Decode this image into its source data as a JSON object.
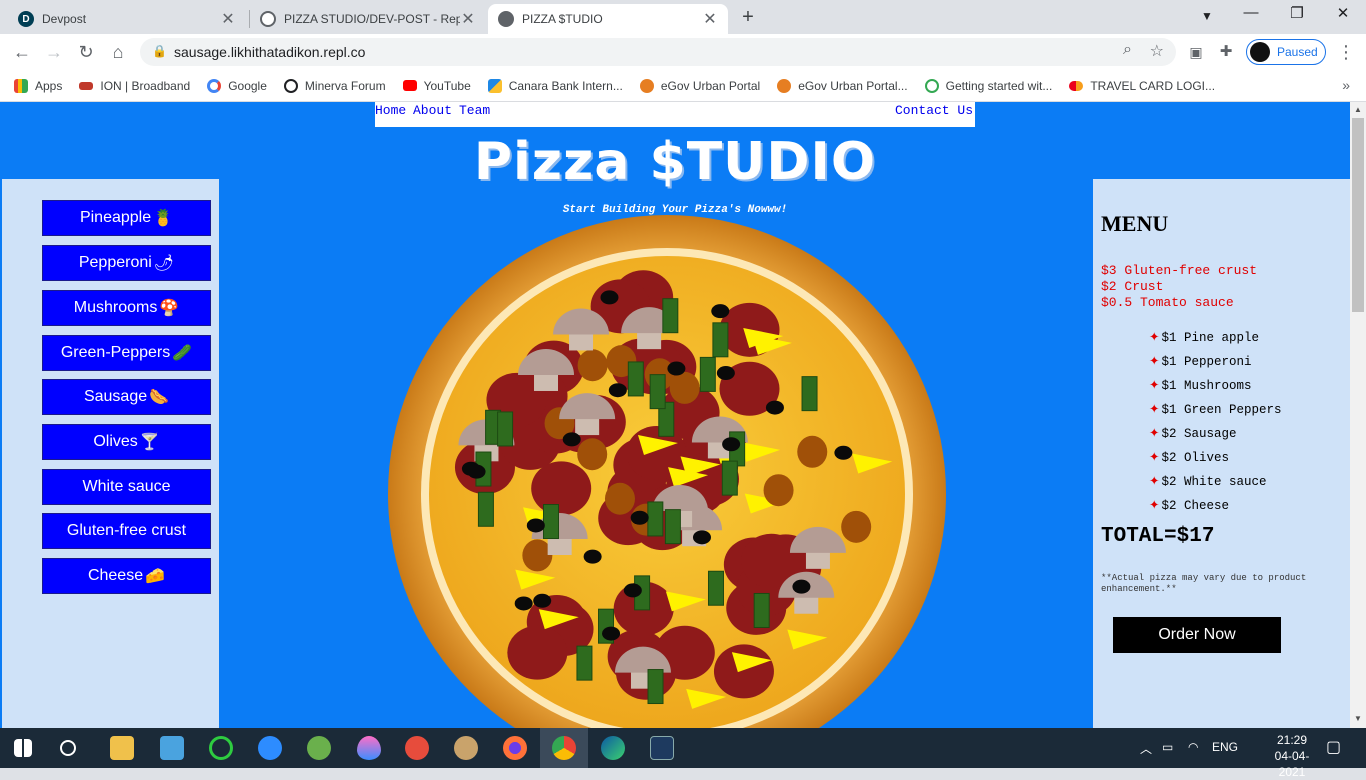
{
  "browser": {
    "tabs": [
      {
        "title": "Devpost",
        "active": false
      },
      {
        "title": "PIZZA STUDIO/DEV-POST - Repl",
        "active": false
      },
      {
        "title": "PIZZA $TUDIO",
        "active": true
      }
    ],
    "url": "sausage.likhithatadikon.repl.co",
    "profile_label": "Paused",
    "bookmarks": [
      "Apps",
      "ION | Broadband",
      "Google",
      "Minerva Forum",
      "YouTube",
      "Canara Bank Intern...",
      "eGov Urban Portal",
      "eGov Urban Portal...",
      "Getting started wit...",
      "TRAVEL CARD LOGI..."
    ]
  },
  "nav": {
    "home": "Home",
    "about": "About",
    "team": "Team",
    "contact": "Contact Us"
  },
  "header": {
    "title": "Pizza $TUDIO",
    "subtitle": "Start Building Your Pizza's Nowww!"
  },
  "ingredients": [
    {
      "label": "Pineapple",
      "emoji": "🍍"
    },
    {
      "label": "Pepperoni",
      "emoji": "🌶"
    },
    {
      "label": "Mushrooms",
      "emoji": "🍄"
    },
    {
      "label": "Green-Peppers",
      "emoji": "🥒"
    },
    {
      "label": "Sausage",
      "emoji": "🌭"
    },
    {
      "label": "Olives",
      "emoji": "🍸"
    },
    {
      "label": "White sauce",
      "emoji": ""
    },
    {
      "label": "Gluten-free crust",
      "emoji": ""
    },
    {
      "label": "Cheese",
      "emoji": "🧀"
    }
  ],
  "menu": {
    "heading": "MENU",
    "base_items": [
      "$3 Gluten-free crust",
      "$2 Crust",
      "$0.5 Tomato sauce"
    ],
    "bullet": "✦",
    "topping_items": [
      "$1 Pine apple",
      "$1 Pepperoni",
      "$1 Mushrooms",
      "$1 Green Peppers",
      "$2 Sausage",
      "$2 Olives",
      "$2 White sauce",
      "$2 Cheese"
    ],
    "total": "TOTAL=$17",
    "note": "**Actual pizza may vary due to product enhancement.**",
    "order_label": "Order Now"
  },
  "taskbar": {
    "lang": "ENG",
    "time": "21:29",
    "date": "04-04-2021"
  },
  "colors": {
    "page_bg": "#0b7cf5",
    "button_bg": "#0000ff",
    "panel_bg": "#cfe2f8",
    "price_red": "#e00000"
  }
}
